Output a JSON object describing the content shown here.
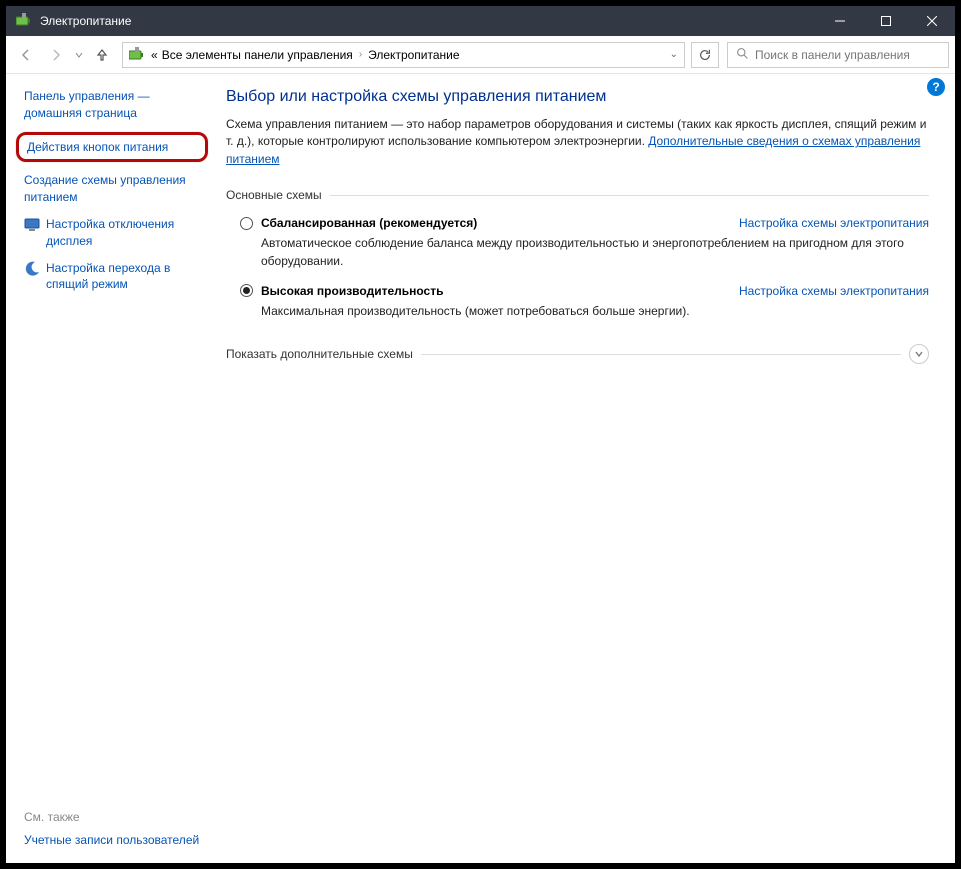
{
  "window": {
    "title": "Электропитание"
  },
  "breadcrumb": {
    "prefix": "«",
    "parent": "Все элементы панели управления",
    "current": "Электропитание"
  },
  "search": {
    "placeholder": "Поиск в панели управления"
  },
  "sidebar": {
    "home": "Панель управления — домашняя страница",
    "buttons": "Действия кнопок питания",
    "create": "Создание схемы управления питанием",
    "display": "Настройка отключения дисплея",
    "sleep": "Настройка перехода в спящий режим"
  },
  "see_also": {
    "title": "См. также",
    "accounts": "Учетные записи пользователей"
  },
  "content": {
    "heading": "Выбор или настройка схемы управления питанием",
    "desc": "Схема управления питанием — это набор параметров оборудования и системы (таких как яркость дисплея, спящий режим и т. д.), которые контролируют использование компьютером электроэнергии.",
    "more_link": "Дополнительные сведения о схемах управления питанием",
    "section_main": "Основные схемы",
    "section_extra": "Показать дополнительные схемы",
    "plan_settings": "Настройка схемы электропитания",
    "plans": {
      "balanced": {
        "name": "Сбалансированная (рекомендуется)",
        "desc": "Автоматическое соблюдение баланса между производительностью и энергопотреблением на пригодном для этого оборудовании."
      },
      "high": {
        "name": "Высокая производительность",
        "desc": "Максимальная производительность (может потребоваться больше энергии)."
      }
    }
  }
}
